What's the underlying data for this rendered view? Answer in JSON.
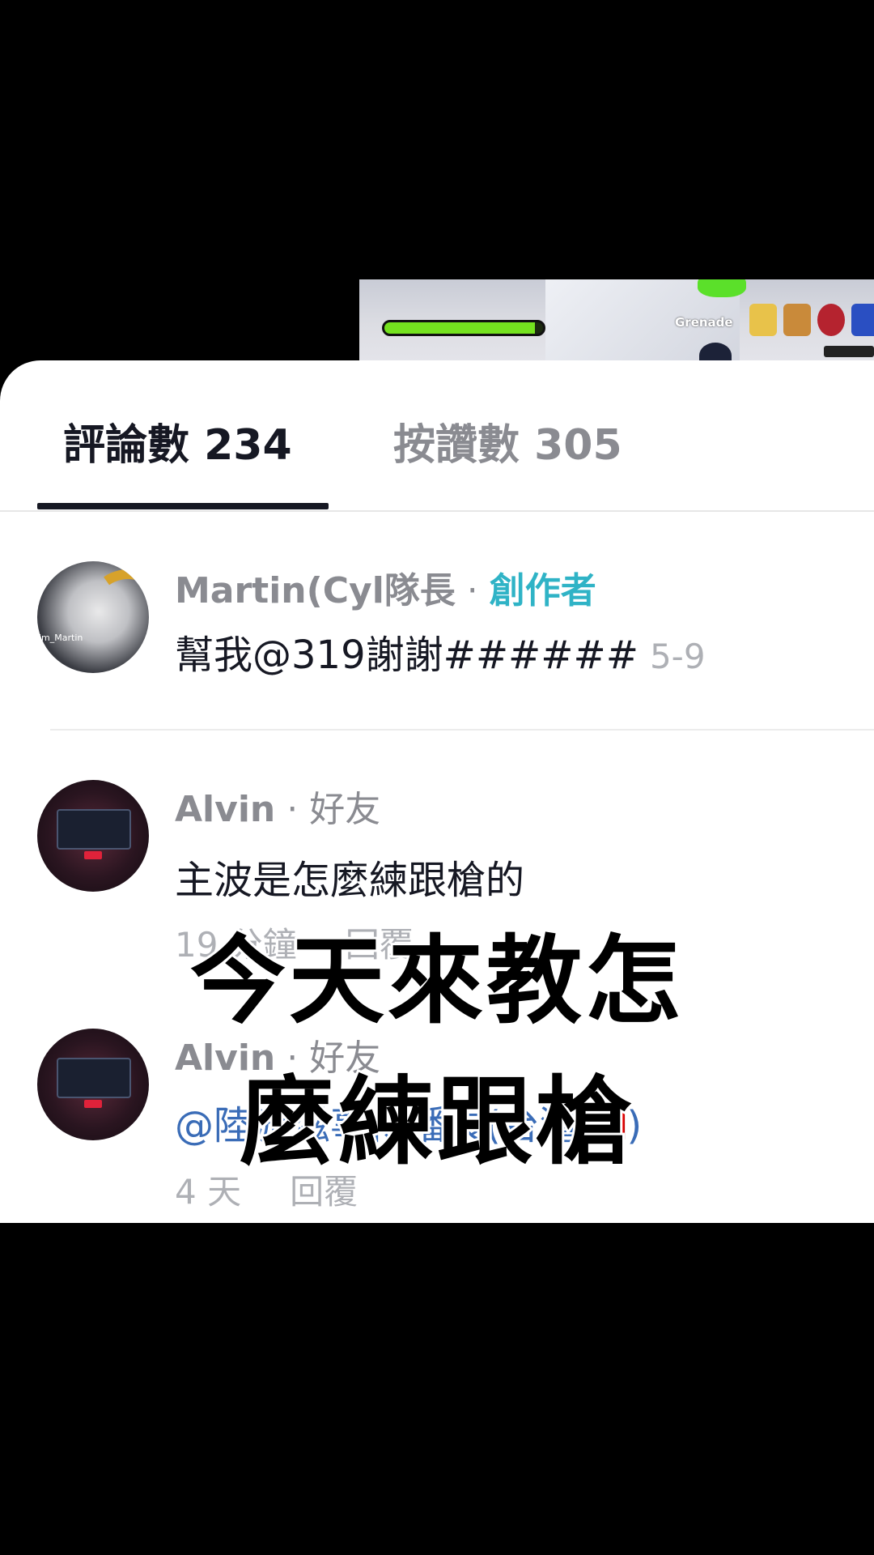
{
  "game_preview": {
    "weapon_label": "Grenade",
    "health_fraction": 0.95
  },
  "tabs": {
    "comments_label": "評論數 234",
    "likes_label": "按讚數 305"
  },
  "comments": [
    {
      "username": "Martin(Cyl隊長",
      "separator": "·",
      "badge": "創作者",
      "avatar_tag": "im_Martin",
      "text": "幫我@319謝謝######",
      "date": "5-9"
    },
    {
      "username": "Alvin",
      "separator": "·",
      "badge": "好友",
      "text": "主波是怎麼練跟槍的",
      "time": "19 分鐘",
      "reply_label": "回覆"
    },
    {
      "username": "Alvin",
      "separator": "·",
      "badge": "好友",
      "text": "@陸游滋事傳播長(台灣🇹🇼)",
      "time": "4 天",
      "reply_label": "回覆"
    }
  ],
  "overlay": {
    "line1": "今天來教怎",
    "line2": "麼練跟槍"
  },
  "colors": {
    "creator_badge": "#2fb3c6",
    "mention": "#3a6cb7",
    "active_tab": "#161823",
    "inactive_tab": "#8a8b91"
  }
}
